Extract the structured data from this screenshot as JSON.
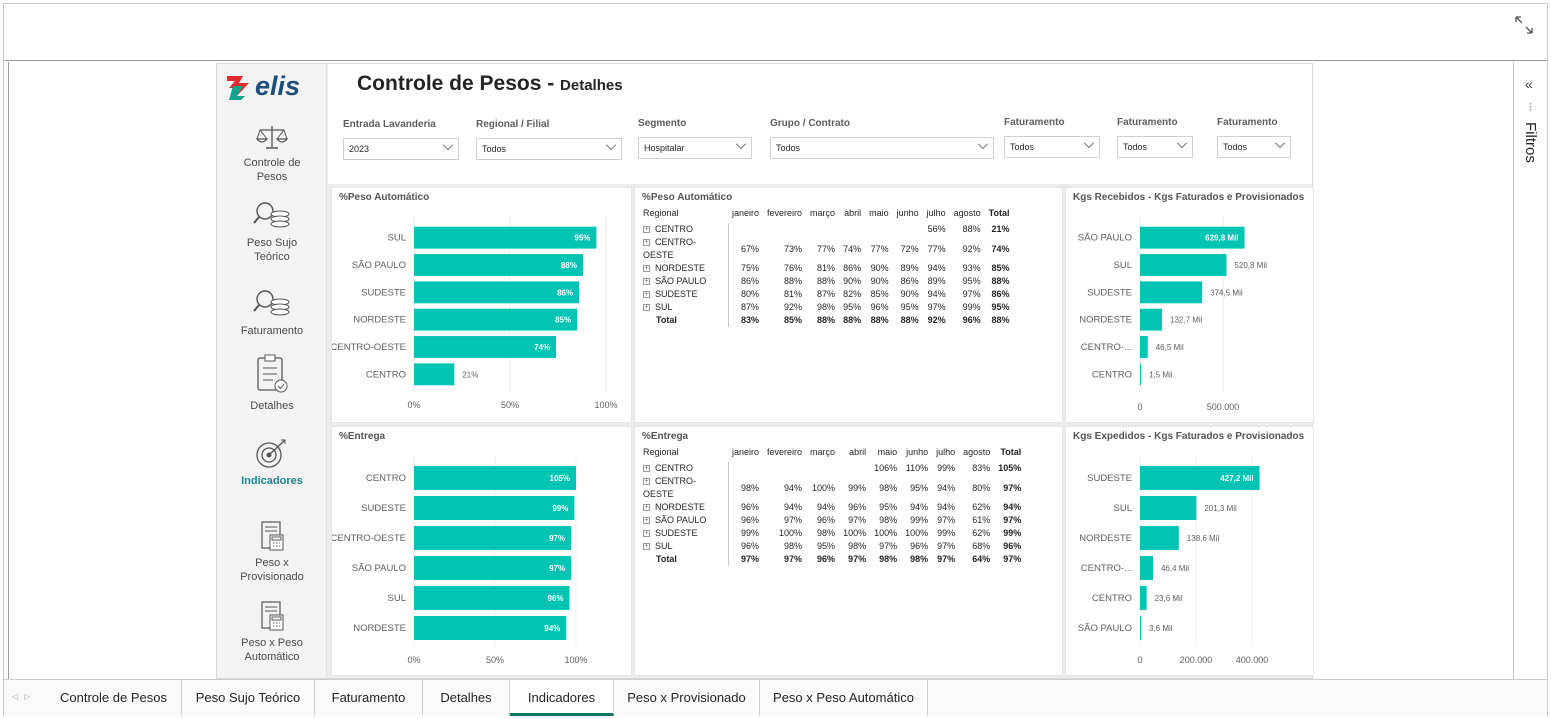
{
  "report": {
    "title": "Controle de Pesos -",
    "subtitle": "Detalhes",
    "logo_text": "elis",
    "brand_color": "#e22c2c",
    "bar_color": "#01c4b3"
  },
  "nav": {
    "items": [
      {
        "label": "Controle de Pesos",
        "icon": "scale-icon"
      },
      {
        "label": "Peso Sujo Teórico",
        "icon": "search-coins-icon"
      },
      {
        "label": "Faturamento",
        "icon": "search-coins-icon"
      },
      {
        "label": "Detalhes",
        "icon": "clipboard-icon"
      },
      {
        "label": "Indicadores",
        "icon": "target-icon"
      },
      {
        "label": "Peso x Provisionado",
        "icon": "calculator-icon"
      },
      {
        "label": "Peso x Peso Automático",
        "icon": "calculator-icon"
      }
    ]
  },
  "filters": [
    {
      "label": "Entrada Lavanderia",
      "value": "2023"
    },
    {
      "label": "Regional / Filial",
      "value": "Todos"
    },
    {
      "label": "Segmento",
      "value": "Hospitalar"
    },
    {
      "label": "Grupo / Contrato",
      "value": "Todos"
    },
    {
      "label": "Faturamento",
      "value": "Todos"
    },
    {
      "label": "Faturamento",
      "value": "Todos"
    },
    {
      "label": "Faturamento",
      "value": "Todos"
    }
  ],
  "filters_pane": {
    "label": "Filtros"
  },
  "matrix_headers": {
    "regional": "Regional",
    "months": [
      "janeiro",
      "fevereiro",
      "março",
      "abril",
      "maio",
      "junho",
      "julho",
      "agosto"
    ],
    "total": "Total"
  },
  "matrix_peso": {
    "title": "%Peso Automático",
    "rows": [
      {
        "name": "CENTRO",
        "vals": [
          "",
          "",
          "",
          "",
          "",
          "",
          "56%",
          "88%"
        ],
        "total": "21%"
      },
      {
        "name": "CENTRO-OESTE",
        "vals": [
          "67%",
          "73%",
          "77%",
          "74%",
          "77%",
          "72%",
          "77%",
          "92%"
        ],
        "total": "74%"
      },
      {
        "name": "NORDESTE",
        "vals": [
          "75%",
          "76%",
          "81%",
          "86%",
          "90%",
          "89%",
          "94%",
          "93%"
        ],
        "total": "85%"
      },
      {
        "name": "SÃO PAULO",
        "vals": [
          "86%",
          "88%",
          "88%",
          "90%",
          "90%",
          "86%",
          "89%",
          "95%"
        ],
        "total": "88%"
      },
      {
        "name": "SUDESTE",
        "vals": [
          "80%",
          "81%",
          "87%",
          "82%",
          "85%",
          "90%",
          "94%",
          "97%"
        ],
        "total": "86%"
      },
      {
        "name": "SUL",
        "vals": [
          "87%",
          "92%",
          "98%",
          "95%",
          "96%",
          "95%",
          "97%",
          "99%"
        ],
        "total": "95%"
      }
    ],
    "total_row": {
      "name": "Total",
      "vals": [
        "83%",
        "85%",
        "88%",
        "88%",
        "88%",
        "88%",
        "92%",
        "96%"
      ],
      "total": "88%"
    }
  },
  "matrix_entrega": {
    "title": "%Entrega",
    "rows": [
      {
        "name": "CENTRO",
        "vals": [
          "",
          "",
          "",
          "",
          "106%",
          "110%",
          "99%",
          "83%"
        ],
        "total": "105%"
      },
      {
        "name": "CENTRO-OESTE",
        "vals": [
          "98%",
          "94%",
          "100%",
          "99%",
          "98%",
          "95%",
          "94%",
          "80%"
        ],
        "total": "97%"
      },
      {
        "name": "NORDESTE",
        "vals": [
          "96%",
          "94%",
          "94%",
          "96%",
          "95%",
          "94%",
          "94%",
          "62%"
        ],
        "total": "94%"
      },
      {
        "name": "SÃO PAULO",
        "vals": [
          "96%",
          "97%",
          "96%",
          "97%",
          "98%",
          "99%",
          "97%",
          "61%"
        ],
        "total": "97%"
      },
      {
        "name": "SUDESTE",
        "vals": [
          "99%",
          "100%",
          "98%",
          "100%",
          "100%",
          "100%",
          "99%",
          "62%"
        ],
        "total": "99%"
      },
      {
        "name": "SUL",
        "vals": [
          "96%",
          "98%",
          "95%",
          "98%",
          "97%",
          "96%",
          "97%",
          "68%"
        ],
        "total": "96%"
      }
    ],
    "total_row": {
      "name": "Total",
      "vals": [
        "97%",
        "97%",
        "96%",
        "97%",
        "98%",
        "98%",
        "97%",
        "64%"
      ],
      "total": "97%"
    }
  },
  "tabs": [
    {
      "label": "Controle de Pesos"
    },
    {
      "label": "Peso Sujo Teórico"
    },
    {
      "label": "Faturamento"
    },
    {
      "label": "Detalhes"
    },
    {
      "label": "Indicadores"
    },
    {
      "label": "Peso x Provisionado"
    },
    {
      "label": "Peso x Peso Automático"
    }
  ],
  "chart_data": [
    {
      "type": "bar",
      "orientation": "horizontal",
      "title": "%Peso Automático",
      "categories": [
        "SUL",
        "SÃO PAULO",
        "SUDESTE",
        "NORDESTE",
        "CENTRO-OESTE",
        "CENTRO"
      ],
      "values": [
        95,
        88,
        86,
        85,
        74,
        21
      ],
      "data_labels": [
        "95%",
        "88%",
        "86%",
        "85%",
        "74%",
        "21%"
      ],
      "xlim": [
        0,
        100
      ],
      "xticks": [
        "0%",
        "50%",
        "100%"
      ]
    },
    {
      "type": "bar",
      "orientation": "horizontal",
      "title": "%Entrega",
      "categories": [
        "CENTRO",
        "SUDESTE",
        "CENTRO-OESTE",
        "SÃO PAULO",
        "SUL",
        "NORDESTE"
      ],
      "values": [
        105,
        99,
        97,
        97,
        96,
        94
      ],
      "data_labels": [
        "105%",
        "99%",
        "97%",
        "97%",
        "96%",
        "94%"
      ],
      "xlim": [
        0,
        100
      ],
      "xticks": [
        "0%",
        "50%",
        "100%"
      ]
    },
    {
      "type": "bar",
      "orientation": "horizontal",
      "title": "Kgs Recebidos - Kgs Faturados e Provisionados",
      "categories": [
        "SÃO PAULO",
        "SUL",
        "SUDESTE",
        "NORDESTE",
        "CENTRO-...",
        "CENTRO"
      ],
      "values": [
        629800,
        520800,
        374500,
        132700,
        46500,
        1500
      ],
      "data_labels": [
        "629,8 Mil",
        "520,8 Mil",
        "374,5 Mil",
        "132,7 Mil",
        "46,5 Mil",
        "1,5 Mil"
      ],
      "xlim": [
        0,
        1000000
      ],
      "xtick_values": [
        0,
        500000
      ],
      "xticks": [
        "0",
        "500.000"
      ]
    },
    {
      "type": "bar",
      "orientation": "horizontal",
      "title": "Kgs Expedidos - Kgs Faturados e Provisionados",
      "categories": [
        "SUDESTE",
        "SUL",
        "NORDESTE",
        "CENTRO-...",
        "CENTRO",
        "SÃO PAULO"
      ],
      "values": [
        427200,
        201300,
        138600,
        46400,
        23600,
        3600
      ],
      "data_labels": [
        "427,2 Mil",
        "201,3 Mil",
        "138,6 Mil",
        "46,4 Mil",
        "23,6 Mil",
        "3,6 Mil"
      ],
      "xlim": [
        0,
        450000
      ],
      "xtick_values": [
        0,
        200000,
        400000
      ],
      "xticks": [
        "0",
        "200.000",
        "400.000"
      ]
    }
  ]
}
